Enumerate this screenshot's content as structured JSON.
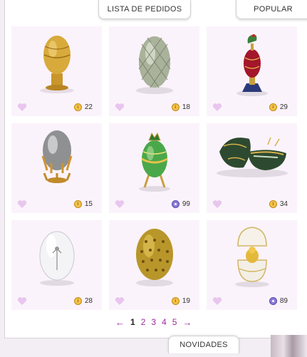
{
  "tabs": {
    "orders_label": "LISTA DE PEDIDOS",
    "popular_label": "POPULAR",
    "new_label": "NOVIDADES"
  },
  "items": [
    {
      "name": "golden-ornate-egg",
      "price": "22",
      "currency": "coin"
    },
    {
      "name": "silver-lattice-egg",
      "price": "18",
      "currency": "coin"
    },
    {
      "name": "rooster-jeweled-egg",
      "price": "29",
      "currency": "coin"
    },
    {
      "name": "silver-drip-egg",
      "price": "15",
      "currency": "coin"
    },
    {
      "name": "green-crowned-egg",
      "price": "99",
      "currency": "gem"
    },
    {
      "name": "green-open-egg",
      "price": "34",
      "currency": "coin"
    },
    {
      "name": "crystal-egg",
      "price": "28",
      "currency": "coin"
    },
    {
      "name": "gold-bead-egg",
      "price": "19",
      "currency": "coin"
    },
    {
      "name": "white-surprise-egg",
      "price": "89",
      "currency": "gem"
    }
  ],
  "pagination": {
    "prev": "←",
    "next": "→",
    "pages": [
      "1",
      "2",
      "3",
      "4",
      "5"
    ],
    "current": "1"
  },
  "colors": {
    "accent": "#9c2a9c",
    "card_bg": "#fbf3fb",
    "heart": "#e8c6ee",
    "coin": "#f1c24a",
    "gem": "#8b7bd8"
  }
}
